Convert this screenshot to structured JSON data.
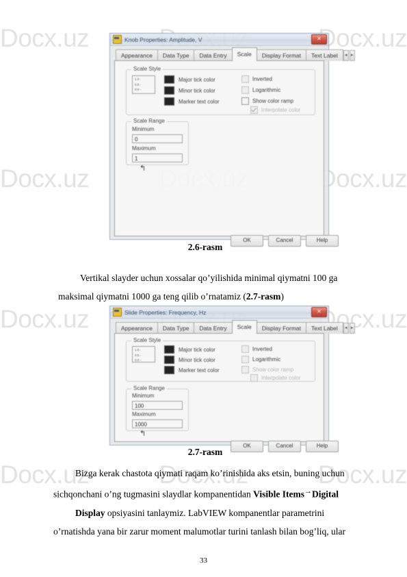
{
  "watermark": {
    "text": "Docx.uz",
    "per_row": 3,
    "rows": 4
  },
  "page": {
    "number": "33"
  },
  "captions": {
    "fig1": "2.6-rasm",
    "fig2": "2.7-rasm"
  },
  "paragraphs": {
    "p1_a": "Vertikal slayder uchun xossalar qo’yilishida minimal qiymatni 100 ga",
    "p1_b": "maksimal qiymatni 1000 ga teng qilib o’rnatamiz (",
    "p1_ref": "2.7-rasm",
    "p1_c": ")",
    "p2_a": "Bizga kerak chastota qiymati raqam ko’rinishida aks etsin, buning uchun",
    "p2_b": "sichqonchani o’ng tugmasini slaydlar kompanentidan ",
    "p2_bold1": "Visible Items",
    "p2_arrow": "→",
    "p2_bold2": "Digital",
    "p3_bold": "Display",
    "p3_a": " opsiyasini tanlaymiz. LabVIEW kompanentlar parametrini",
    "p3_b": "o’rnatishda yana bir zarur moment malumotlar turini tanlash bilan bog’liq, ular"
  },
  "dialog1": {
    "title": "Knob Properties: Amplitude, V",
    "close_label": "✕",
    "tabs": [
      {
        "label": "Appearance",
        "active": false
      },
      {
        "label": "Data Type",
        "active": false
      },
      {
        "label": "Data Entry",
        "active": false
      },
      {
        "label": "Scale",
        "active": true
      },
      {
        "label": "Display Format",
        "active": false
      },
      {
        "label": "Text Label",
        "active": false
      }
    ],
    "tab_scroll_left": "◄",
    "tab_scroll_right": "►",
    "scale_style": {
      "legend": "Scale Style",
      "preview_ticks": [
        "1.0 -",
        "0.5 -",
        "0.0 -"
      ],
      "colors": [
        {
          "label": "Major tick color",
          "color": "#080808"
        },
        {
          "label": "Minor tick color",
          "color": "#080808"
        },
        {
          "label": "Marker text color",
          "color": "#080808"
        }
      ],
      "options": [
        {
          "label": "Inverted",
          "checked": false,
          "disabled": true
        },
        {
          "label": "Logarithmic",
          "checked": false,
          "disabled": true
        },
        {
          "label": "Show color ramp",
          "checked": false,
          "disabled": false
        },
        {
          "label": "Interpolate color",
          "checked": true,
          "disabled": true
        }
      ]
    },
    "scale_range": {
      "legend": "Scale Range",
      "minimum_label": "Minimum",
      "minimum_value": "0",
      "maximum_label": "Maximum",
      "maximum_value": "1"
    },
    "buttons": [
      "OK",
      "Cancel",
      "Help"
    ],
    "cursor": "↰"
  },
  "dialog2": {
    "title": "Slide Properties: Frequency, Hz",
    "close_label": "✕",
    "tabs": [
      {
        "label": "Appearance",
        "active": false
      },
      {
        "label": "Data Type",
        "active": false
      },
      {
        "label": "Data Entry",
        "active": false
      },
      {
        "label": "Scale",
        "active": true
      },
      {
        "label": "Display Format",
        "active": false
      },
      {
        "label": "Text Label",
        "active": false
      }
    ],
    "tab_scroll_left": "◄",
    "tab_scroll_right": "►",
    "scale_style": {
      "legend": "Scale Style",
      "preview_ticks": [
        "1.0 -",
        "0.5 -",
        "0.0 -"
      ],
      "colors": [
        {
          "label": "Major tick color",
          "color": "#080808"
        },
        {
          "label": "Minor tick color",
          "color": "#080808"
        },
        {
          "label": "Marker text color",
          "color": "#080808"
        }
      ],
      "options": [
        {
          "label": "Inverted",
          "checked": false,
          "disabled": true
        },
        {
          "label": "Logarithmic",
          "checked": false,
          "disabled": true
        },
        {
          "label": "Show color ramp",
          "checked": false,
          "disabled": true
        },
        {
          "label": "Interpolate color",
          "checked": false,
          "disabled": true
        }
      ]
    },
    "scale_range": {
      "legend": "Scale Range",
      "minimum_label": "Minimum",
      "minimum_value": "100",
      "maximum_label": "Maximum",
      "maximum_value": "1000"
    },
    "buttons": [
      "OK",
      "Cancel",
      "Help"
    ],
    "cursor": "↰"
  }
}
